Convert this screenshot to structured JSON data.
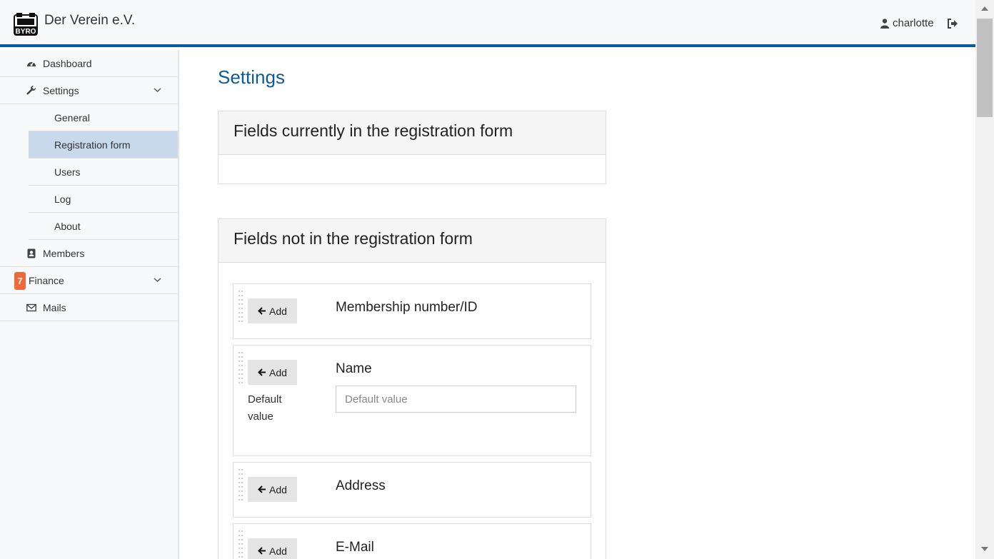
{
  "header": {
    "logo_text": "BYRO",
    "org_name": "Der Verein e.V.",
    "username": "charlotte"
  },
  "sidebar": {
    "items": [
      {
        "label": "Dashboard",
        "icon": "dashboard-icon"
      },
      {
        "label": "Settings",
        "icon": "wrench-icon",
        "expanded": true,
        "children": [
          {
            "label": "General"
          },
          {
            "label": "Registration form",
            "active": true
          },
          {
            "label": "Users"
          },
          {
            "label": "Log"
          },
          {
            "label": "About"
          }
        ]
      },
      {
        "label": "Members",
        "icon": "address-book-icon"
      },
      {
        "label": "Finance",
        "badge": "7",
        "expanded": false
      },
      {
        "label": "Mails",
        "icon": "envelope-icon"
      }
    ]
  },
  "main": {
    "title": "Settings",
    "current_section": {
      "heading": "Fields currently in the registration form"
    },
    "other_section": {
      "heading": "Fields not in the registration form",
      "add_label": "Add",
      "default_value_label": "Default value",
      "default_value_placeholder": "Default value",
      "fields": [
        {
          "name": "Membership number/ID"
        },
        {
          "name": "Name",
          "has_default": true
        },
        {
          "name": "Address"
        },
        {
          "name": "E-Mail"
        }
      ]
    }
  },
  "colors": {
    "brand": "#0d5a9b",
    "active_nav": "#c7d9ea",
    "badge": "#ee6a3d"
  }
}
